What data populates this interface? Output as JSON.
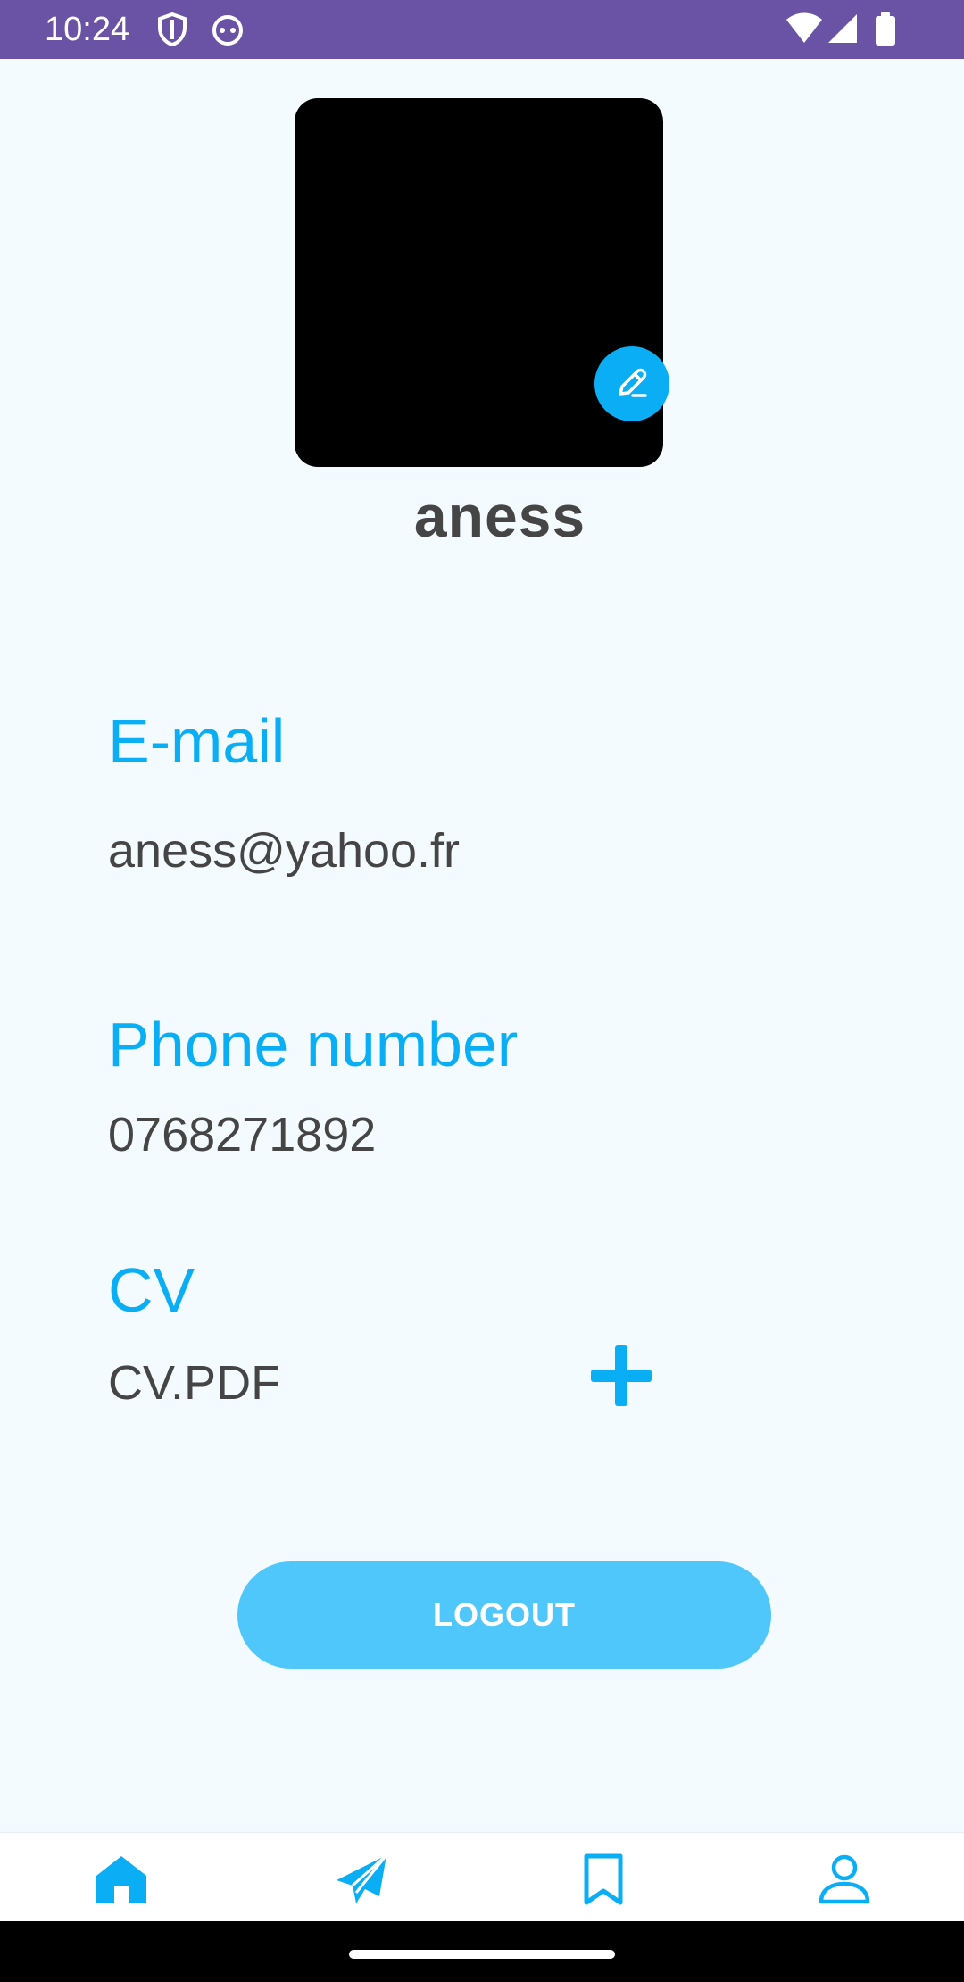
{
  "status_bar": {
    "time": "10:24",
    "icons": [
      "shield-icon",
      "android-bot-icon",
      "wifi-icon",
      "cell-signal-icon",
      "battery-icon"
    ]
  },
  "profile": {
    "username": "aness",
    "edit_icon": "pencil-icon"
  },
  "email": {
    "label": "E-mail",
    "value": "aness@yahoo.fr"
  },
  "phone": {
    "label": "Phone number",
    "value": "0768271892"
  },
  "cv": {
    "label": "CV",
    "file": "CV.PDF",
    "add_icon": "plus-icon"
  },
  "logout_label": "LOGOUT",
  "bottom_nav": [
    {
      "name": "home",
      "icon": "home-icon",
      "active": true
    },
    {
      "name": "send",
      "icon": "send-icon",
      "active": false
    },
    {
      "name": "saved",
      "icon": "bookmark-icon",
      "active": false
    },
    {
      "name": "profile",
      "icon": "person-icon",
      "active": false
    }
  ],
  "colors": {
    "accent": "#0AAEF5",
    "status_bar": "#6A53A5",
    "background": "#F3FBFE",
    "button": "#4FC7FB",
    "text": "#454545"
  }
}
